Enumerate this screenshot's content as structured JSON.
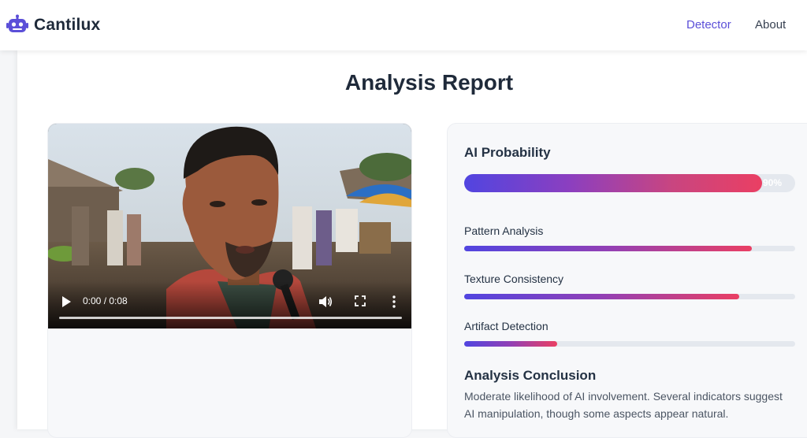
{
  "nav": {
    "brand": "Cantilux",
    "brand_icon": "robot-icon",
    "links": [
      {
        "label": "Detector",
        "active": true
      },
      {
        "label": "About",
        "active": false
      }
    ]
  },
  "page": {
    "title": "Analysis Report"
  },
  "video": {
    "time": "0:00 / 0:08",
    "progress": 0,
    "icons": [
      "play-icon",
      "volume-icon",
      "fullscreen-icon",
      "more-vertical-icon"
    ]
  },
  "results": {
    "ai_probability": {
      "label": "AI Probability",
      "percent": 90,
      "percent_text": "90%"
    },
    "metrics": [
      {
        "label": "Pattern Analysis",
        "percent": 87
      },
      {
        "label": "Texture Consistency",
        "percent": 83
      },
      {
        "label": "Artifact Detection",
        "percent": 28
      }
    ],
    "conclusion_title": "Analysis Conclusion",
    "conclusion_text": "Moderate likelihood of AI involvement. Several indicators suggest AI manipulation, though some aspects appear natural."
  },
  "colors": {
    "accent": "#5b4fd8",
    "gradient_start": "#5145e0",
    "gradient_end": "#ea3f63",
    "track": "#e4e8ee"
  }
}
